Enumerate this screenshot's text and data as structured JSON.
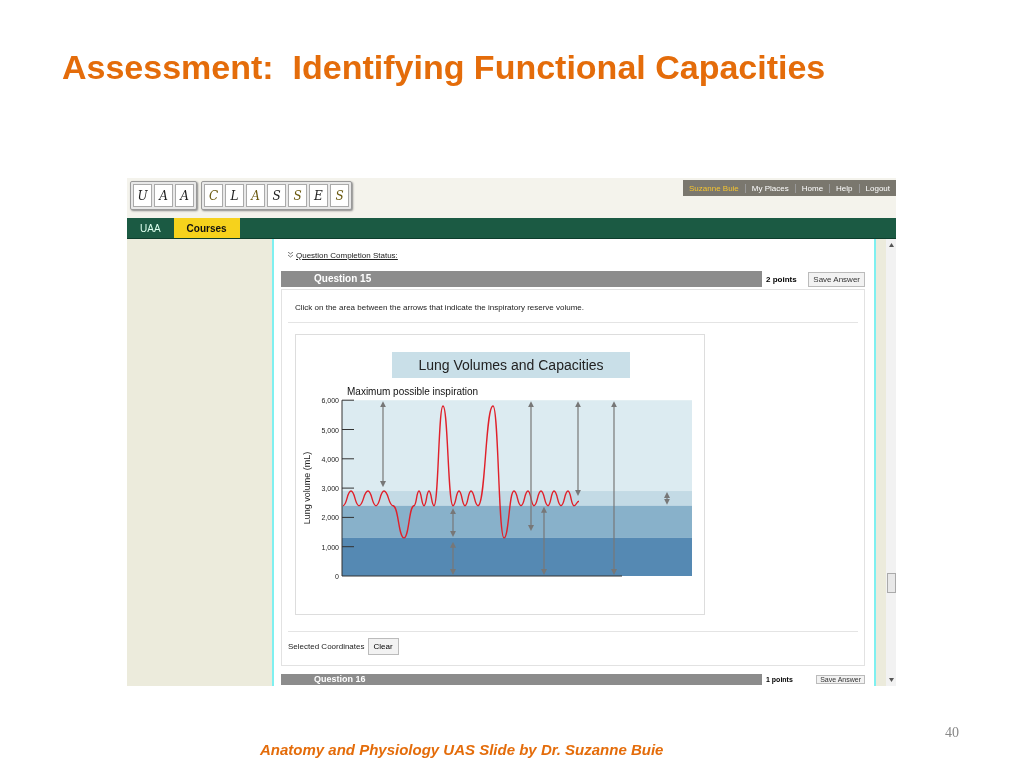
{
  "slide": {
    "title": "Assessment:  Identifying Functional Capacities",
    "footer": "Anatomy and Physiology UAS Slide by Dr. Suzanne Buie",
    "page_number": "40"
  },
  "app": {
    "logo_groups": [
      [
        "U",
        "A",
        "A"
      ],
      [
        "C",
        "L",
        "A",
        "S",
        "S",
        "E",
        "S"
      ]
    ],
    "user_menu": [
      {
        "label": "Suzanne Buie",
        "kind": "user"
      },
      {
        "label": "My Places",
        "kind": "link"
      },
      {
        "label": "Home",
        "kind": "link"
      },
      {
        "label": "Help",
        "kind": "link"
      },
      {
        "label": "Logout",
        "kind": "link"
      }
    ],
    "tabs": [
      {
        "label": "UAA",
        "selected": false
      },
      {
        "label": "Courses",
        "selected": true
      }
    ],
    "completion_link": "Question Completion Status:",
    "questions": [
      {
        "title": "Question 15",
        "points": "2 points",
        "save": "Save Answer",
        "prompt": "Click on the area between the arrows that indicate the inspiratory reserve volume.",
        "figure": {
          "title": "Lung Volumes and Capacities",
          "annotation": "Maximum possible inspiration",
          "y_axis_label": "Lung volume (mL)",
          "y_ticks": [
            "6,000",
            "5,000",
            "4,000",
            "3,000",
            "2,000",
            "1,000",
            "0"
          ]
        },
        "coordinates_label": "Selected Coordinates",
        "clear": "Clear"
      },
      {
        "title": "Question 16",
        "points": "1 points",
        "save": "Save Answer"
      }
    ]
  }
}
